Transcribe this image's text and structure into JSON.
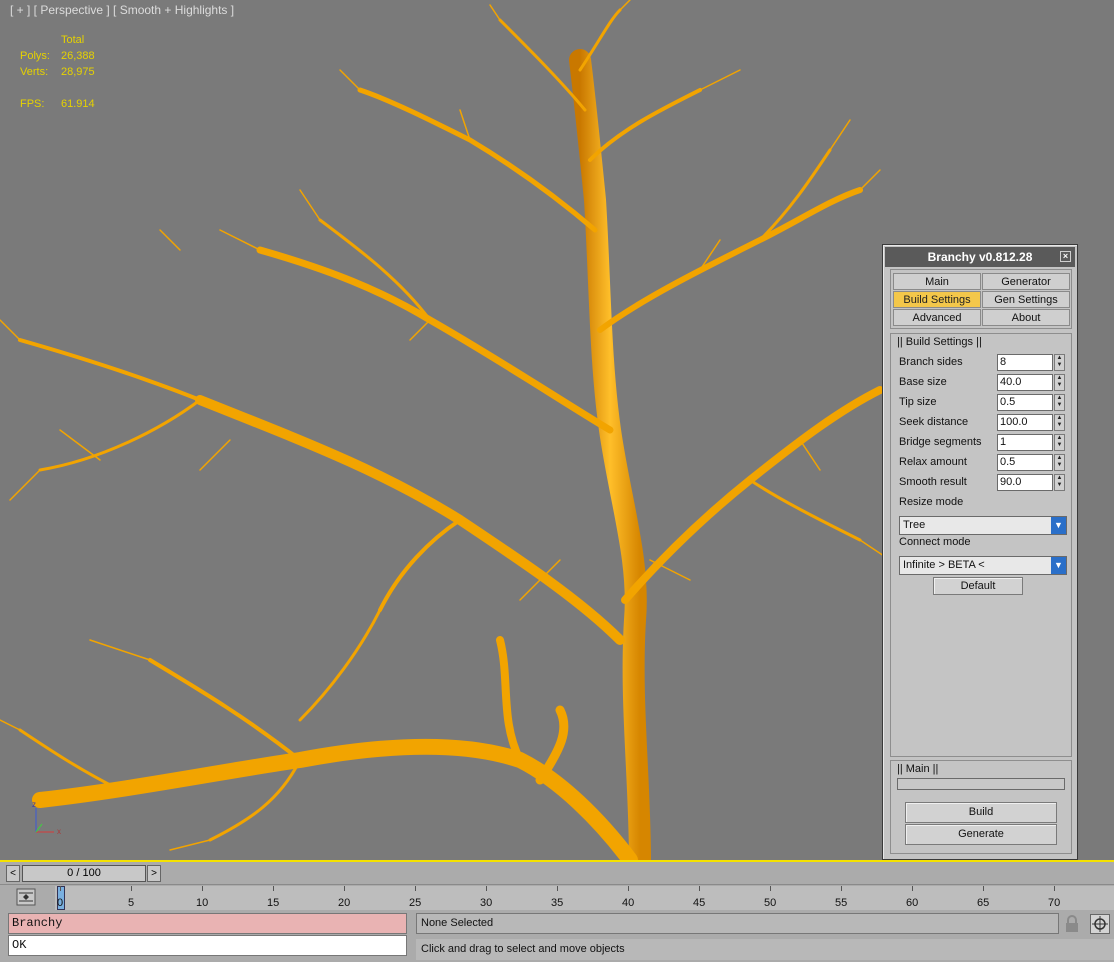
{
  "viewport": {
    "label": "[ + ] [ Perspective ] [ Smooth + Highlights ]",
    "stats": {
      "total_label": "Total",
      "polys_label": "Polys:",
      "polys_value": "26,388",
      "verts_label": "Verts:",
      "verts_value": "28,975",
      "fps_label": "FPS:",
      "fps_value": "61.914"
    },
    "axis": {
      "z": "z",
      "x": "x"
    }
  },
  "panel": {
    "title": "Branchy v0.812.28",
    "close_glyph": "×",
    "tabs": [
      {
        "label": "Main",
        "active": false
      },
      {
        "label": "Generator",
        "active": false
      },
      {
        "label": "Build Settings",
        "active": true
      },
      {
        "label": "Gen Settings",
        "active": false
      },
      {
        "label": "Advanced",
        "active": false
      },
      {
        "label": "About",
        "active": false
      }
    ],
    "build_group_title": "|| Build Settings ||",
    "params": [
      {
        "label": "Branch sides",
        "value": "8"
      },
      {
        "label": "Base size",
        "value": "40.0"
      },
      {
        "label": "Tip size",
        "value": "0.5"
      },
      {
        "label": "Seek distance",
        "value": "100.0"
      },
      {
        "label": "Bridge segments",
        "value": "1"
      },
      {
        "label": "Relax amount",
        "value": "0.5"
      },
      {
        "label": "Smooth result",
        "value": "90.0"
      }
    ],
    "resize_mode_label": "Resize mode",
    "resize_mode_value": "Tree",
    "connect_mode_label": "Connect mode",
    "connect_mode_value": "Infinite > BETA <",
    "default_button": "Default",
    "main_group_title": "|| Main ||",
    "build_button": "Build",
    "generate_button": "Generate"
  },
  "timeline": {
    "frame_display": "0 / 100",
    "prev_glyph": "<",
    "next_glyph": ">",
    "ticks": [
      "0",
      "5",
      "10",
      "15",
      "20",
      "25",
      "30",
      "35",
      "40",
      "45",
      "50",
      "55",
      "60",
      "65",
      "70"
    ]
  },
  "status": {
    "maxscript_line1": "Branchy",
    "maxscript_line2": "OK",
    "selection": "None Selected",
    "prompt": "Click and drag to select and move objects"
  },
  "colors": {
    "viewport_bg": "#7a7a7a",
    "tree": "#f2a400",
    "stats_text": "#e6d200",
    "active_tab": "#f3c74a",
    "maxscript_bg": "#e9b3b3"
  }
}
